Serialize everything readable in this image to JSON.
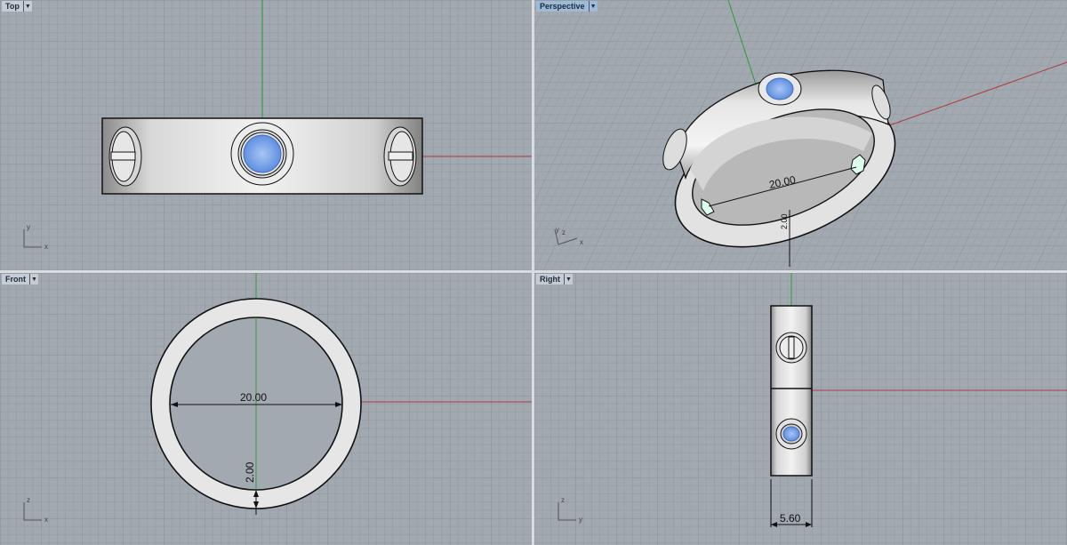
{
  "viewports": {
    "top": {
      "label": "Top",
      "axes": [
        "y",
        "x"
      ]
    },
    "perspective": {
      "label": "Perspective",
      "axes": [
        "y",
        "z",
        "x"
      ],
      "dim_diameter": "20.00",
      "dim_thickness": "2.00"
    },
    "front": {
      "label": "Front",
      "axes": [
        "z",
        "x"
      ],
      "dim_diameter": "20.00",
      "dim_thickness": "2.00"
    },
    "right": {
      "label": "Right",
      "axes": [
        "z",
        "y"
      ],
      "dim_width": "5.60"
    }
  },
  "colors": {
    "viewport_bg": "#a2a9b1",
    "grid_minor": "#959ca5",
    "grid_major": "#868d96",
    "x_axis": "#b03a3a",
    "y_axis": "#2e9a3a",
    "active_label": "#9dbbd8",
    "gem": "#7aa6ee"
  },
  "icons": {
    "dropdown": "chevron-down-icon"
  }
}
